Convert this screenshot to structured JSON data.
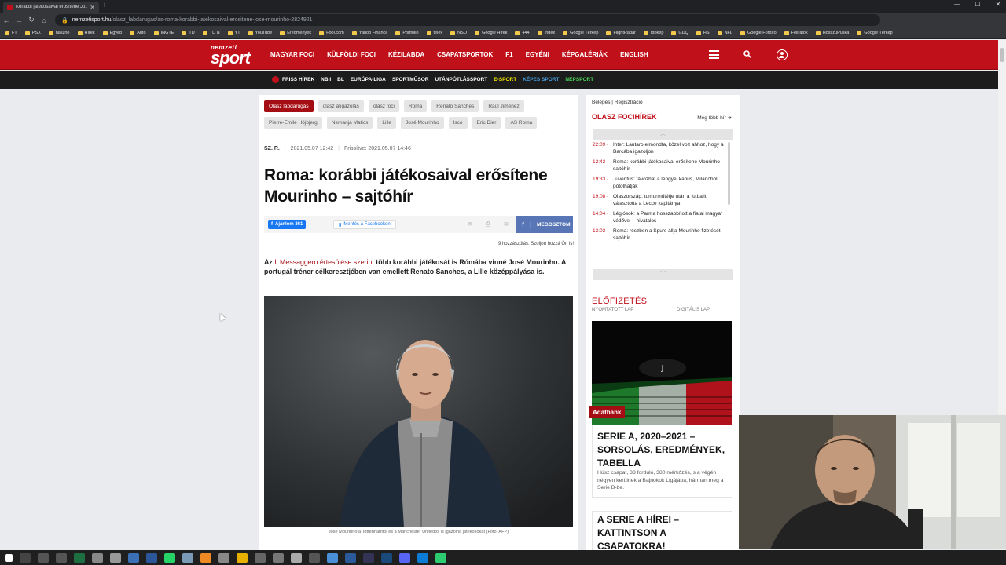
{
  "browser": {
    "tab_title": "Korábbi játékosaival erősítene Jo...",
    "url_host": "nemzetisport.hu",
    "url_path": "/olasz_labdarugas/as-roma-korabbi-jatekosaival-erositene-jose-mourinho-2824921",
    "bookmarks": [
      "FT",
      "PSX",
      "haszno",
      "Hírek",
      "Egyéb",
      "Autó",
      "INGTE",
      "TD",
      "TD N",
      "YT",
      "YouTube",
      "Eredmények",
      "Fool.com",
      "Yahoo Finance",
      "Portfolio",
      "telex",
      "NSO",
      "Google Hírek",
      "444",
      "Index",
      "Google Térkép",
      "FlightRadar",
      "Időkép",
      "GDQ",
      "HS",
      "NFL",
      "Google Fordító",
      "Feliratok",
      "HosszuPuska",
      "Google Térkép"
    ]
  },
  "site": {
    "logo_line1": "nemzeti",
    "logo_line2": "sport",
    "main_nav": [
      "MAGYAR FOCI",
      "KÜLFÖLDI FOCI",
      "KÉZILABDA",
      "CSAPATSPORTOK",
      "F1",
      "EGYÉNI",
      "KÉPGALÉRIÁK",
      "ENGLISH"
    ],
    "sub_nav": [
      {
        "label": "FRISS HÍREK",
        "color": "#ffffff"
      },
      {
        "label": "NB I",
        "color": "#ffffff"
      },
      {
        "label": "BL",
        "color": "#ffffff"
      },
      {
        "label": "EURÓPA-LIGA",
        "color": "#ffffff"
      },
      {
        "label": "SPORTMŰSOR",
        "color": "#ffffff"
      },
      {
        "label": "UTÁNPÓTLÁSSPORT",
        "color": "#ffffff"
      },
      {
        "label": "E-SPORT",
        "color": "#f2e600"
      },
      {
        "label": "KÉPES SPORT",
        "color": "#4a9fe0"
      },
      {
        "label": "NÉPSPORT",
        "color": "#4cd35a"
      }
    ]
  },
  "article": {
    "tags": [
      "Olasz labdarúgás",
      "olasz átigazolás",
      "olasz foci",
      "Roma",
      "Renato Sanches",
      "Raúl Jiménez",
      "Pierre-Emile Höjbjerg",
      "Nemanja Matics",
      "Lille",
      "José Mourinho",
      "Isco",
      "Eric Dier",
      "AS Roma"
    ],
    "author": "SZ. R.",
    "date": "2021.05.07 12:42",
    "updated": "Frissítve: 2021.05.07 14:46",
    "headline": "Roma: korábbi játékosaival erősítene Mourinho – sajtóhír",
    "fb_like": "Ajánlom 361",
    "fb_save": "Mentés a Facebookon",
    "share_label": "MEGOSZTOM",
    "comments": "9 hozzászólás. Szóljon hozzá Ön is!",
    "lead_pre": "Az ",
    "lead_link": "Il Messaggero értesülése szerint",
    "lead_post": " több korábbi játékosát is Rómába vinné José Mourinho. A portugál tréner célkeresztjében van emellett Renato Sanches, a Lille középpályása is.",
    "caption": "José Mourinho a Tottenhamtől és a Manchester Unitedtől is igazolna játékosokat (Fotó: AFP)"
  },
  "sidebar": {
    "login": "Belépés",
    "register": "Regisztráció",
    "section_title": "OLASZ FOCIHÍREK",
    "more": "Még több hír",
    "news": [
      {
        "time": "22:09",
        "title": "Inter: Lautaro elmondta, közel volt ahhoz, hogy a Barcába igazoljon"
      },
      {
        "time": "12:42",
        "title": "Roma: korábbi játékosaival erősítene Mourinho – sajtóhír"
      },
      {
        "time": "19:33",
        "title": "Juventus: távozhat a lengyel kapus, Milánóból pótolhatják"
      },
      {
        "time": "19:08",
        "title": "Olaszország: tumorműtétje után a futballt választotta a Lecce kapitánya"
      },
      {
        "time": "14:04",
        "title": "Légiósok: a Parma hosszabbított a fiatal magyar védővel – hivatalos"
      },
      {
        "time": "13:03",
        "title": "Roma: részben a Spurs állja Mourinho fizetését – sajtóhír"
      }
    ],
    "subscribe": "ELŐFIZETÉS",
    "printed": "NYOMTATOTT LAP",
    "digital": "DIGITÁLIS LAP",
    "badge": "Adatbank",
    "card1_title": "SERIE A, 2020–2021 – SORSOLÁS, EREDMÉNYEK, TABELLA",
    "card1_text": "Húsz csapat, 38 forduló, 380 mérkőzés, s a végén négyen kerülnek a Bajnokok Ligájába, hárman meg a Serie B-be.",
    "card2_title": "A SERIE A HÍREI – KATTINTSON A CSAPATOKRA!"
  },
  "colors": {
    "brand_red": "#c0101a",
    "dark_red": "#a50d14",
    "fb_blue": "#5876b6"
  }
}
